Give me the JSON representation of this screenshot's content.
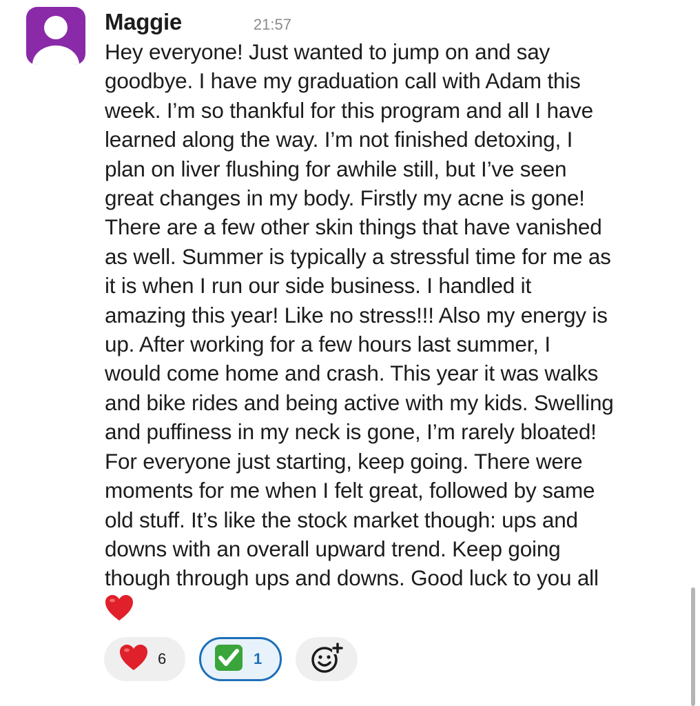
{
  "message": {
    "author": "Maggie",
    "timestamp": "21:57",
    "text": "Hey everyone! Just wanted to jump on and say\ngoodbye. I have my graduation call with Adam this\nweek. I’m so thankful for this program and all I have\nlearned along the way. I’m not finished detoxing, I\nplan on liver flushing for awhile still, but I’ve seen\ngreat changes in my body. Firstly my acne is gone!\nThere are a few other skin things that have vanished\nas well. Summer is typically a stressful time for me as\nit is when I run our side business. I handled it\namazing this year! Like no stress!!! Also my energy is\nup. After working for a few hours last summer, I\nwould come home and crash. This year it was walks\nand bike rides and being active with my kids. Swelling\nand puffiness in my neck is gone, I’m rarely bloated!\nFor everyone just starting, keep going. There were\nmoments for me when I felt great, followed by same\nold stuff. It’s like the stock market though: ups and\ndowns with an overall upward trend. Keep going\nthough through ups and downs. Good luck to you all",
    "trailing_emoji": "red-heart-icon"
  },
  "reactions": [
    {
      "emoji": "red-heart-icon",
      "count": "6",
      "selected": false
    },
    {
      "emoji": "white-check-mark-icon",
      "count": "1",
      "selected": true
    }
  ],
  "add_reaction": {
    "icon": "add-emoji-icon"
  },
  "colors": {
    "avatar_bg": "#8a2aa8",
    "selected_border": "#1d6fb8",
    "pill_bg": "#efefef",
    "heart": "#e0202a",
    "check": "#3aa53a"
  }
}
